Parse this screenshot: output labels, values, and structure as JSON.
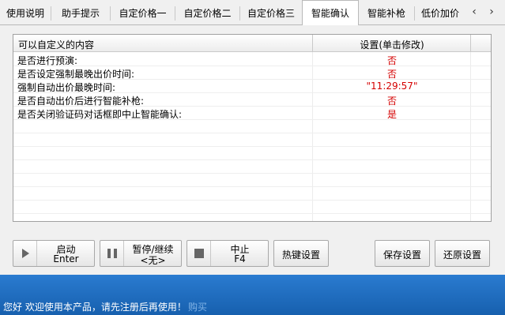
{
  "tabs": [
    {
      "label": "使用说明"
    },
    {
      "label": "助手提示"
    },
    {
      "label": "自定价格一"
    },
    {
      "label": "自定价格二"
    },
    {
      "label": "自定价格三"
    },
    {
      "label": "智能确认"
    },
    {
      "label": "智能补枪"
    },
    {
      "label": "低价加价"
    }
  ],
  "tab_scroll": {
    "left": "‹",
    "right": "›"
  },
  "grid": {
    "col1": "可以自定义的内容",
    "col2": "设置(单击修改)",
    "rows": [
      {
        "key": "是否进行预演:",
        "value": "否"
      },
      {
        "key": "是否设定强制最晚出价时间:",
        "value": "否"
      },
      {
        "key": "强制自动出价最晚时间:",
        "value": "\"11:29:57\""
      },
      {
        "key": "是否自动出价后进行智能补枪:",
        "value": "否"
      },
      {
        "key": "是否关闭验证码对话框即中止智能确认:",
        "value": "是"
      }
    ]
  },
  "buttons": {
    "start": {
      "line1": "启动",
      "line2": "Enter"
    },
    "pause": {
      "line1": "暂停/继续",
      "line2": "<无>"
    },
    "stop": {
      "line1": "中止",
      "line2": "F4"
    },
    "hotkey": "热键设置",
    "save": "保存设置",
    "restore": "还原设置"
  },
  "status": {
    "message": "您好 欢迎使用本产品，请先注册后再使用！",
    "link": "购买"
  }
}
